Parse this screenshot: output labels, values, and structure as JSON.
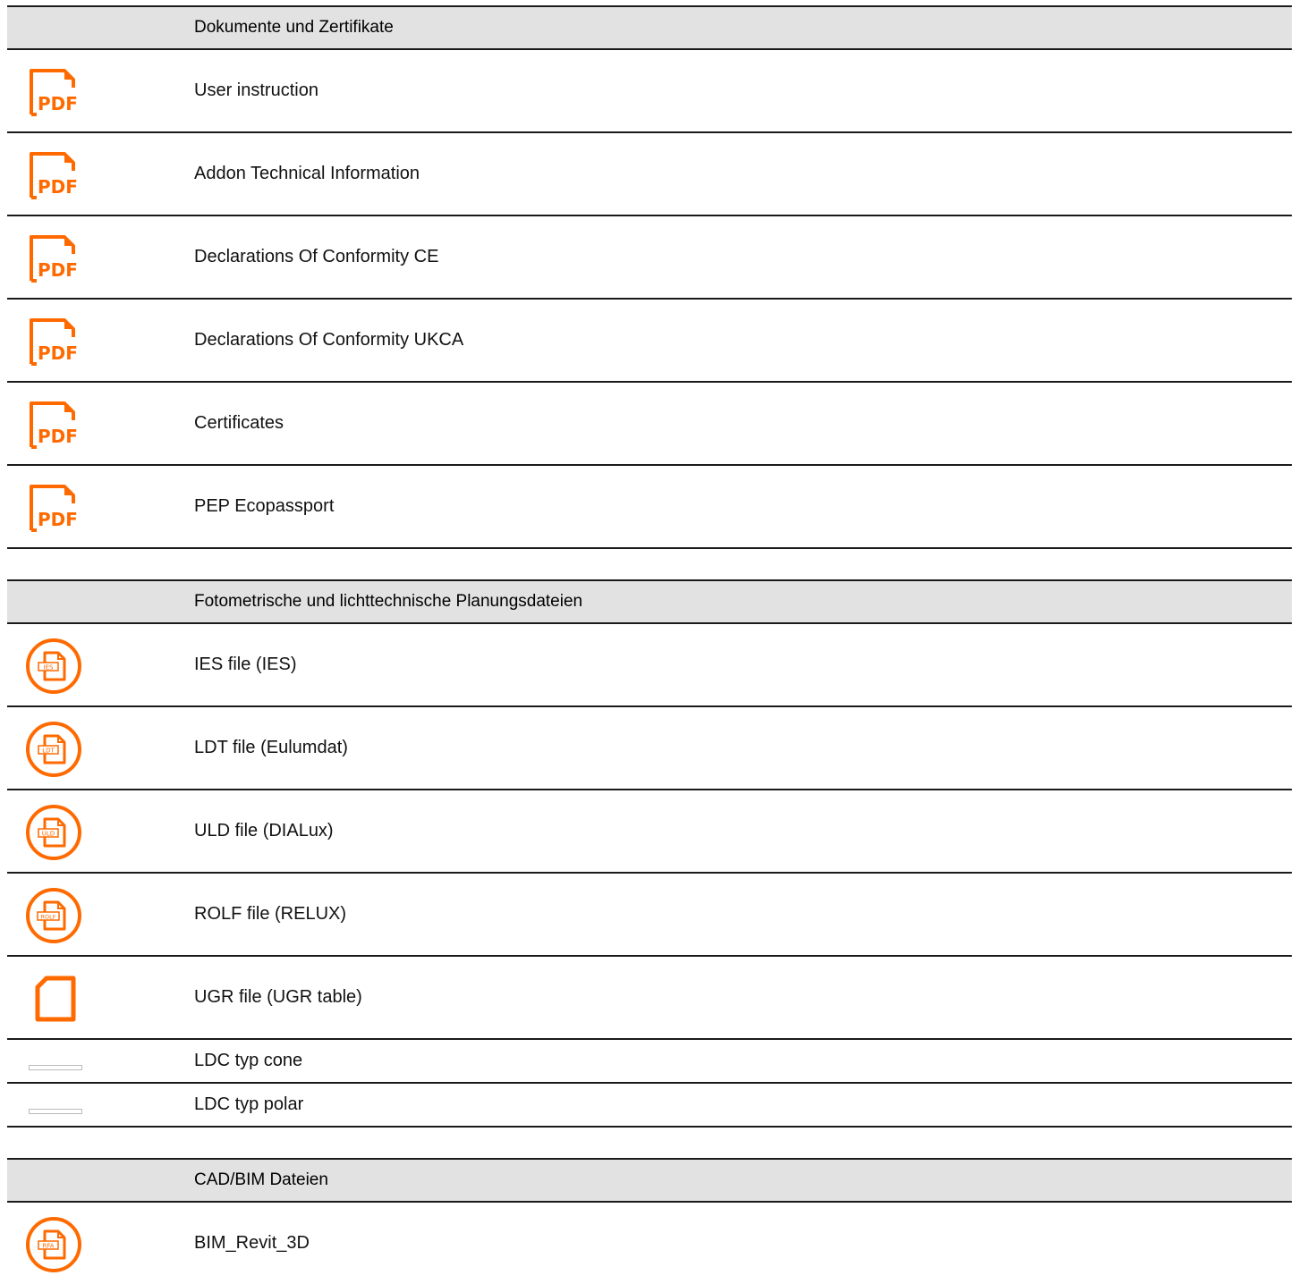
{
  "colors": {
    "accent": "#ff6a00",
    "header_bg": "#e2e2e2",
    "divider": "#1a1a1a"
  },
  "sections": [
    {
      "title": "Dokumente und Zertifikate",
      "items": [
        {
          "label": "User instruction",
          "icon": "pdf-icon",
          "icon_text": "PDF"
        },
        {
          "label": "Addon Technical Information",
          "icon": "pdf-icon",
          "icon_text": "PDF"
        },
        {
          "label": "Declarations Of Conformity CE",
          "icon": "pdf-icon",
          "icon_text": "PDF"
        },
        {
          "label": "Declarations Of Conformity UKCA",
          "icon": "pdf-icon",
          "icon_text": "PDF"
        },
        {
          "label": "Certificates",
          "icon": "pdf-icon",
          "icon_text": "PDF"
        },
        {
          "label": "PEP Ecopassport",
          "icon": "pdf-icon",
          "icon_text": "PDF"
        }
      ]
    },
    {
      "title": "Fotometrische und lichttechnische Planungsdateien",
      "items": [
        {
          "label": "IES file (IES)",
          "icon": "ies-file-icon",
          "icon_text": "IES"
        },
        {
          "label": "LDT file (Eulumdat)",
          "icon": "ldt-file-icon",
          "icon_text": "LDT"
        },
        {
          "label": "ULD file (DIALux)",
          "icon": "uld-file-icon",
          "icon_text": "ULD"
        },
        {
          "label": "ROLF file (RELUX)",
          "icon": "rolf-file-icon",
          "icon_text": "ROLF"
        },
        {
          "label": "UGR file (UGR table)",
          "icon": "blank-file-icon"
        },
        {
          "label": "LDC typ cone",
          "icon": "image-placeholder-icon"
        },
        {
          "label": "LDC typ polar",
          "icon": "image-placeholder-icon"
        }
      ]
    },
    {
      "title": "CAD/BIM Dateien",
      "items": [
        {
          "label": "BIM_Revit_3D",
          "icon": "rfa-file-icon",
          "icon_text": "RFA"
        }
      ]
    }
  ]
}
